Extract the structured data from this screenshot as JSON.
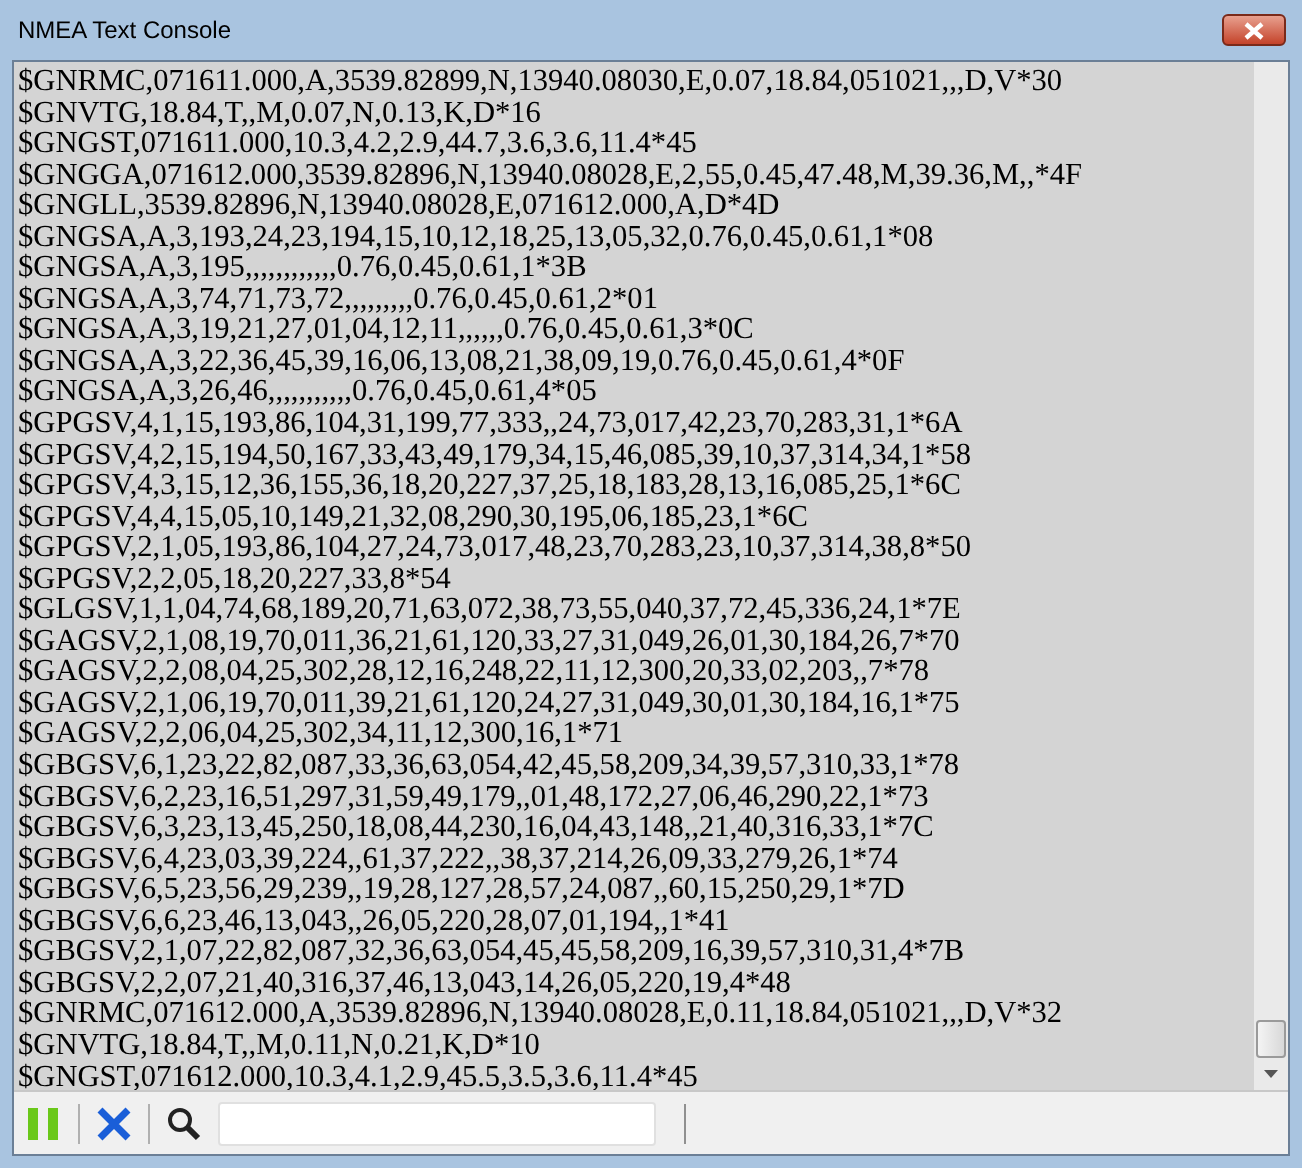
{
  "window": {
    "title": "NMEA Text Console"
  },
  "console_lines": [
    "$GNRMC,071611.000,A,3539.82899,N,13940.08030,E,0.07,18.84,051021,,,D,V*30",
    "$GNVTG,18.84,T,,M,0.07,N,0.13,K,D*16",
    "$GNGST,071611.000,10.3,4.2,2.9,44.7,3.6,3.6,11.4*45",
    "$GNGGA,071612.000,3539.82896,N,13940.08028,E,2,55,0.45,47.48,M,39.36,M,,*4F",
    "$GNGLL,3539.82896,N,13940.08028,E,071612.000,A,D*4D",
    "$GNGSA,A,3,193,24,23,194,15,10,12,18,25,13,05,32,0.76,0.45,0.61,1*08",
    "$GNGSA,A,3,195,,,,,,,,,,,,0.76,0.45,0.61,1*3B",
    "$GNGSA,A,3,74,71,73,72,,,,,,,,,0.76,0.45,0.61,2*01",
    "$GNGSA,A,3,19,21,27,01,04,12,11,,,,,,0.76,0.45,0.61,3*0C",
    "$GNGSA,A,3,22,36,45,39,16,06,13,08,21,38,09,19,0.76,0.45,0.61,4*0F",
    "$GNGSA,A,3,26,46,,,,,,,,,,,0.76,0.45,0.61,4*05",
    "$GPGSV,4,1,15,193,86,104,31,199,77,333,,24,73,017,42,23,70,283,31,1*6A",
    "$GPGSV,4,2,15,194,50,167,33,43,49,179,34,15,46,085,39,10,37,314,34,1*58",
    "$GPGSV,4,3,15,12,36,155,36,18,20,227,37,25,18,183,28,13,16,085,25,1*6C",
    "$GPGSV,4,4,15,05,10,149,21,32,08,290,30,195,06,185,23,1*6C",
    "$GPGSV,2,1,05,193,86,104,27,24,73,017,48,23,70,283,23,10,37,314,38,8*50",
    "$GPGSV,2,2,05,18,20,227,33,8*54",
    "$GLGSV,1,1,04,74,68,189,20,71,63,072,38,73,55,040,37,72,45,336,24,1*7E",
    "$GAGSV,2,1,08,19,70,011,36,21,61,120,33,27,31,049,26,01,30,184,26,7*70",
    "$GAGSV,2,2,08,04,25,302,28,12,16,248,22,11,12,300,20,33,02,203,,7*78",
    "$GAGSV,2,1,06,19,70,011,39,21,61,120,24,27,31,049,30,01,30,184,16,1*75",
    "$GAGSV,2,2,06,04,25,302,34,11,12,300,16,1*71",
    "$GBGSV,6,1,23,22,82,087,33,36,63,054,42,45,58,209,34,39,57,310,33,1*78",
    "$GBGSV,6,2,23,16,51,297,31,59,49,179,,01,48,172,27,06,46,290,22,1*73",
    "$GBGSV,6,3,23,13,45,250,18,08,44,230,16,04,43,148,,21,40,316,33,1*7C",
    "$GBGSV,6,4,23,03,39,224,,61,37,222,,38,37,214,26,09,33,279,26,1*74",
    "$GBGSV,6,5,23,56,29,239,,19,28,127,28,57,24,087,,60,15,250,29,1*7D",
    "$GBGSV,6,6,23,46,13,043,,26,05,220,28,07,01,194,,1*41",
    "$GBGSV,2,1,07,22,82,087,32,36,63,054,45,45,58,209,16,39,57,310,31,4*7B",
    "$GBGSV,2,2,07,21,40,316,37,46,13,043,14,26,05,220,19,4*48",
    "$GNRMC,071612.000,A,3539.82896,N,13940.08028,E,0.11,18.84,051021,,,D,V*32",
    "$GNVTG,18.84,T,,M,0.11,N,0.21,K,D*10",
    "$GNGST,071612.000,10.3,4.1,2.9,45.5,3.5,3.6,11.4*45"
  ]
}
